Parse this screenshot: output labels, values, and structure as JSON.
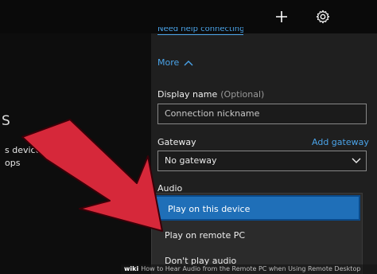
{
  "toolbar": {
    "add_icon": "plus-icon",
    "settings_icon": "gear-icon"
  },
  "left_preview": {
    "frag_s": "S",
    "frag_device": "s device.",
    "frag_ps": "ops"
  },
  "panel": {
    "help_link": "Need help connecting?",
    "more_label": "More",
    "display_name_label": "Display name",
    "display_name_optional": "(Optional)",
    "display_name_placeholder": "Connection nickname",
    "gateway_label": "Gateway",
    "add_gateway_label": "Add gateway",
    "gateway_value": "No gateway",
    "audio_label": "Audio",
    "audio_options": [
      "Play on this device",
      "Play on remote PC",
      "Don't play audio"
    ]
  },
  "watermark": {
    "brand": "wiki",
    "title": "How to Hear Audio from the Remote PC when Using Remote Desktop"
  },
  "colors": {
    "accent": "#4aa3e8",
    "selected": "#1f6fb8",
    "arrow": "#d6283a"
  }
}
